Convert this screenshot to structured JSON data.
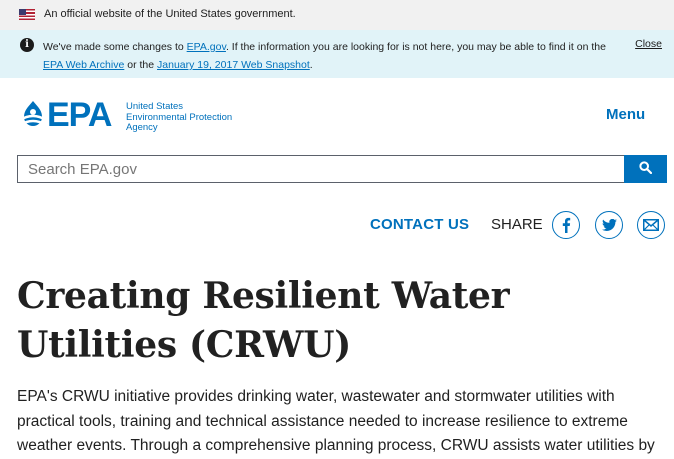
{
  "gov_banner": {
    "text": "An official website of the United States government."
  },
  "notice": {
    "part1": "We've made some changes to ",
    "link1": "EPA.gov",
    "part2": ". If the information you are looking for is not here, you may be able to find it on the ",
    "link2": "EPA Web Archive",
    "part3": " or the ",
    "link3": "January 19, 2017 Web Snapshot",
    "part4": ".",
    "close_label": "Close"
  },
  "header": {
    "logo_text": "EPA",
    "agency_line1": "United States",
    "agency_line2": "Environmental Protection",
    "agency_line3": "Agency",
    "menu_label": "Menu"
  },
  "search": {
    "placeholder": "Search EPA.gov",
    "value": ""
  },
  "share_bar": {
    "contact_label": "CONTACT US",
    "share_label": "SHARE",
    "icons": [
      "facebook-icon",
      "twitter-icon",
      "email-icon"
    ]
  },
  "main": {
    "title": "Creating Resilient Water Utilities (CRWU)",
    "intro": "EPA's CRWU initiative provides drinking water, wastewater and stormwater utilities with practical tools, training and technical assistance needed to increase resilience to extreme weather events. Through a comprehensive planning process, CRWU assists water utilities by"
  },
  "colors": {
    "brand_blue": "#0071bc",
    "notice_bg": "#e1f3f8",
    "banner_bg": "#f1f1f1"
  }
}
